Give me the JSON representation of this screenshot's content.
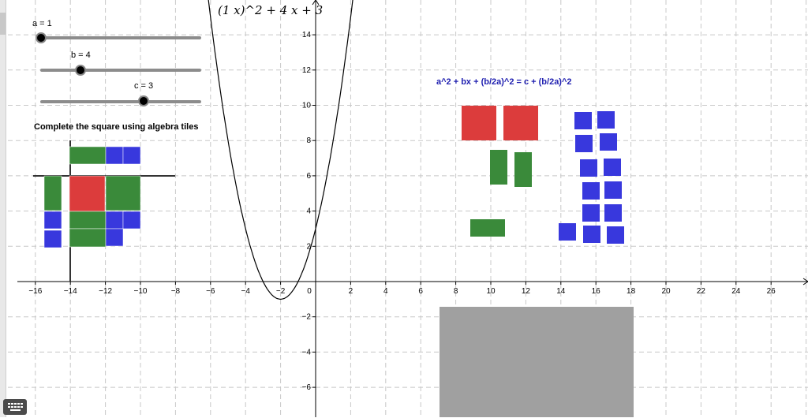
{
  "formula": "(1 x)^2 + 4 x + 3",
  "sliders": [
    {
      "label": "a = 1",
      "value": 1,
      "min": -5,
      "max": 5
    },
    {
      "label": "b = 4",
      "value": 4,
      "min": -10,
      "max": 10
    },
    {
      "label": "c = 3",
      "value": 3,
      "min": -10,
      "max": 10
    }
  ],
  "instruction": "Complete the square using algebra tiles",
  "equation": "a^2 + bx + (b/2a)^2 = c + (b/2a)^2",
  "x_ticks": [
    "−16",
    "−14",
    "−12",
    "−10",
    "−8",
    "−6",
    "−4",
    "−2",
    "0",
    "2",
    "4",
    "6",
    "8",
    "10",
    "12",
    "14",
    "16",
    "18",
    "20",
    "22",
    "24",
    "26"
  ],
  "y_ticks": [
    "14",
    "12",
    "10",
    "8",
    "6",
    "4",
    "2",
    "−2",
    "−4",
    "−6"
  ],
  "colors": {
    "x2_tile": "#dc3c3c",
    "x_tile": "#3a8a3a",
    "unit_tile": "#3838dd",
    "drop_zone": "#a0a0a0",
    "equation_text": "#1f1fb0",
    "grid": "#c8c8c8",
    "axis": "#000000"
  },
  "icons": {
    "keyboard": "keyboard-icon"
  }
}
